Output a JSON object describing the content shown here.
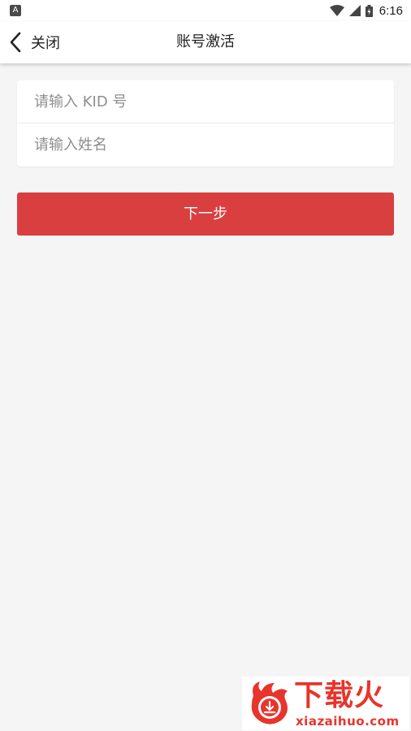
{
  "status_bar": {
    "notification_icon": "A",
    "time": "6:16"
  },
  "nav": {
    "back_label": "关闭",
    "title": "账号激活"
  },
  "form": {
    "kid_placeholder": "请输入 KID 号",
    "kid_value": "",
    "name_placeholder": "请输入姓名",
    "name_value": ""
  },
  "actions": {
    "next_label": "下一步"
  },
  "watermark": {
    "brand": "下载火",
    "site": "xiazaihuo.com"
  },
  "colors": {
    "primary": "#d93f3f",
    "background": "#f5f5f5",
    "watermark": "#e8342b"
  }
}
